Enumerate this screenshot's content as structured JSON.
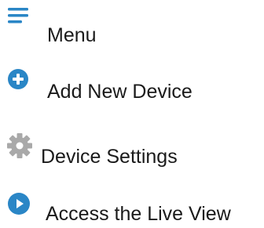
{
  "items": [
    {
      "id": "menu",
      "label": "Menu",
      "icon": "hamburger-menu-icon"
    },
    {
      "id": "add",
      "label": "Add New Device",
      "icon": "plus-circle-icon"
    },
    {
      "id": "settings",
      "label": "Device Settings",
      "icon": "gear-icon"
    },
    {
      "id": "live",
      "label": "Access the Live View",
      "icon": "play-circle-icon"
    }
  ],
  "colors": {
    "accent": "#2a86c6",
    "gear": "#a9a9a9",
    "text": "#1a1a1a"
  }
}
